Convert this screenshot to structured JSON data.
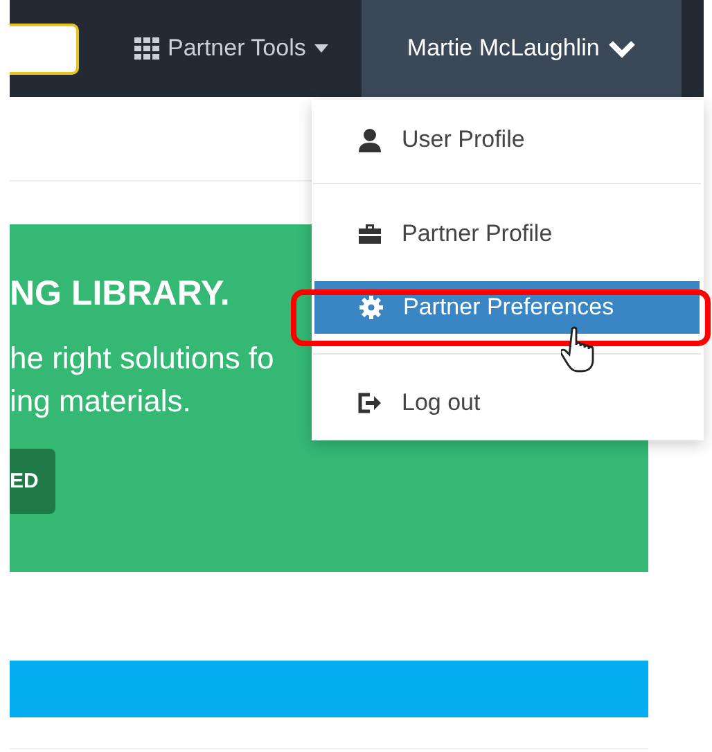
{
  "navbar": {
    "search_field": {
      "kind": "field"
    },
    "partner_tools": {
      "label": "Partner Tools"
    },
    "user_menu": {
      "label": "Martie McLaughlin",
      "expanded": true
    }
  },
  "dropdown": {
    "items": [
      {
        "label": "User Profile",
        "selected": false,
        "divider_before": false,
        "highlight_box": false,
        "cursor": false
      },
      {
        "label": "Partner Profile",
        "selected": false,
        "divider_before": true,
        "highlight_box": false,
        "cursor": false
      },
      {
        "label": "Partner Preferences",
        "selected": true,
        "divider_before": false,
        "highlight_box": true,
        "cursor": true
      },
      {
        "label": "Log out",
        "selected": false,
        "divider_before": true,
        "highlight_box": false,
        "cursor": false
      }
    ]
  },
  "banner": {
    "title": "NG LIBRARY.",
    "lines": [
      "he right solutions fo",
      "ing materials."
    ],
    "button": "ED"
  }
}
